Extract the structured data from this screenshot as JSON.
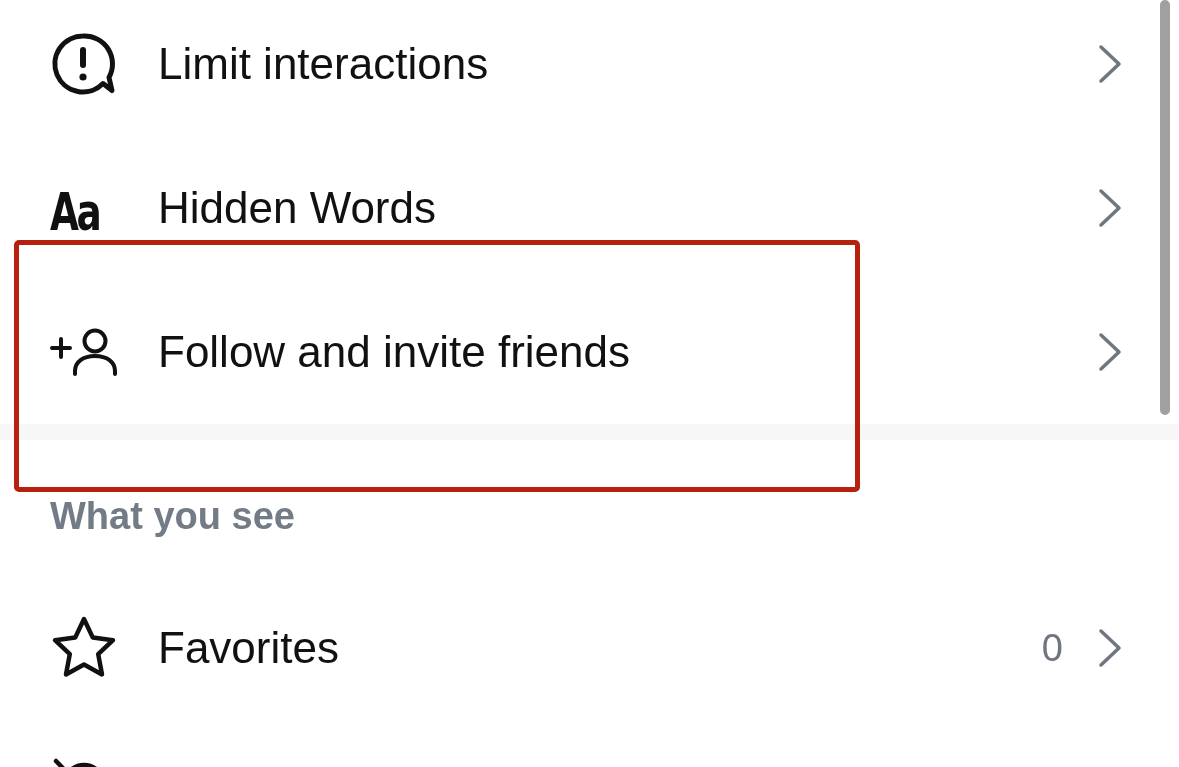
{
  "groups": [
    {
      "items": [
        {
          "kind": "alert",
          "label": "Limit interactions",
          "highlighted": false
        },
        {
          "kind": "glyph",
          "icon_text": "Aa",
          "label": "Hidden Words",
          "highlighted": false
        },
        {
          "kind": "invite",
          "label": "Follow and invite friends",
          "highlighted": true
        }
      ]
    },
    {
      "header": "What you see",
      "items": [
        {
          "kind": "star",
          "label": "Favorites",
          "count": "0",
          "highlighted": false
        },
        {
          "kind": "muted"
        }
      ]
    }
  ]
}
